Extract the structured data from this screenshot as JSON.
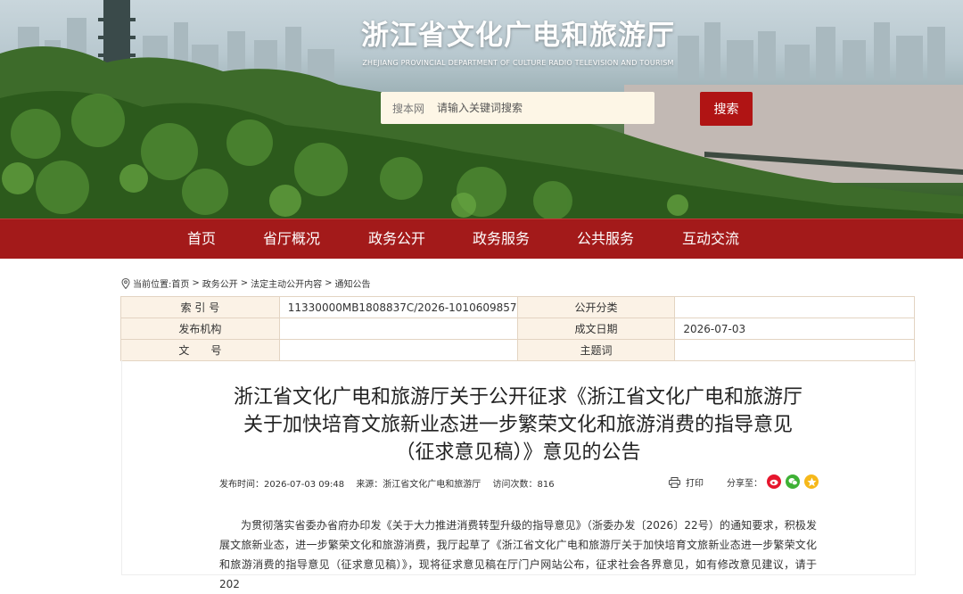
{
  "header": {
    "title": "浙江省文化广电和旅游厅",
    "subtitle": "ZHEJIANG PROVINCIAL DEPARTMENT OF CULTURE RADIO TELEVISION AND TOURISM",
    "search": {
      "scope": "搜本网",
      "placeholder": "请输入关键词搜索",
      "button_label": "搜索"
    }
  },
  "nav": {
    "items": [
      "首页",
      "省厅概况",
      "政务公开",
      "政务服务",
      "公共服务",
      "互动交流"
    ]
  },
  "breadcrumb": {
    "prefix": "当前位置:",
    "items": [
      "首页",
      "政务公开",
      "法定主动公开内容",
      "通知公告"
    ],
    "separator": ">"
  },
  "meta": {
    "index_label": "索 引 号",
    "index_value": "11330000MB1808837C/2026-1010609857",
    "category_label": "公开分类",
    "category_value": "",
    "publisher_label": "发布机构",
    "publisher_value": "",
    "date_label": "成文日期",
    "date_value": "2026-07-03",
    "doc_label": "文　　号",
    "doc_value": "",
    "subject_label": "主题词",
    "subject_value": ""
  },
  "article": {
    "title_line1": "浙江省文化广电和旅游厅关于公开征求《浙江省文化广电和旅游厅",
    "title_line2": "关于加快培育文旅新业态进一步繁荣文化和旅游消费的指导意见",
    "title_line3": "（征求意见稿）》意见的公告",
    "publish_time": "发布时间：2026-07-03 09:48",
    "source": "来源：浙江省文化广电和旅游厅",
    "visits": "访问次数：816",
    "print_label": "打印",
    "share_label": "分享至：",
    "body": "为贯彻落实省委办省府办印发《关于大力推进消费转型升级的指导意见》（浙委办发〔2026〕22号）的通知要求，积极发展文旅新业态，进一步繁荣文化和旅游消费，我厅起草了《浙江省文化广电和旅游厅关于加快培育文旅新业态进一步繁荣文化和旅游消费的指导意见（征求意见稿）》，现将征求意见稿在厅门户网站公布，征求社会各界意见，如有修改意见建议，请于202"
  },
  "colors": {
    "nav_bg": "#a31a1a",
    "search_btn": "#b01414",
    "table_key_bg": "#fbf2e6",
    "weibo": "#e6162d",
    "wechat": "#3eb135",
    "qzone": "#f6b81a"
  },
  "icons": {
    "location": "location-pin-icon",
    "print": "printer-icon",
    "weibo": "weibo-icon",
    "wechat": "wechat-icon",
    "qzone": "qzone-star-icon"
  }
}
